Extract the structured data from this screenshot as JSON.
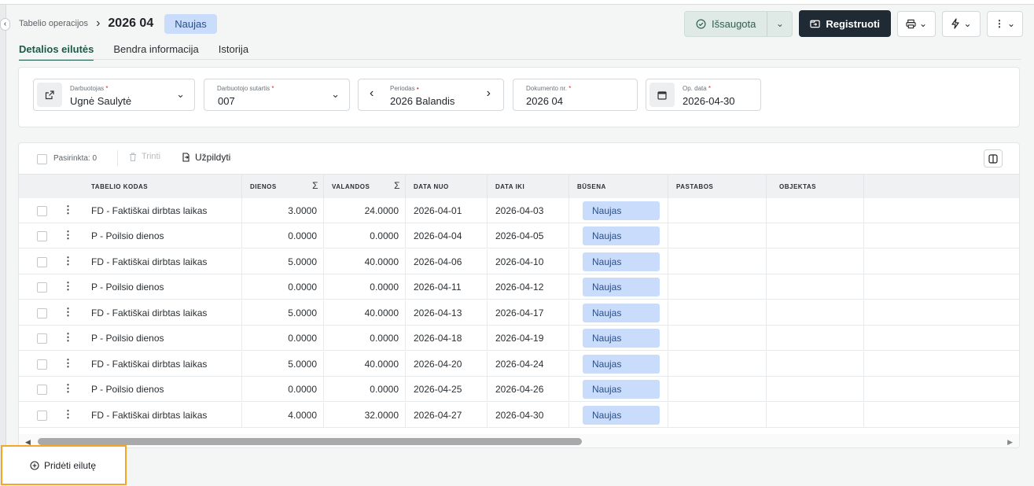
{
  "header": {
    "breadcrumb_link": "Tabelio operacijos",
    "title": "2026 04",
    "status_badge": "Naujas",
    "saved_label": "Išsaugota",
    "register_label": "Registruoti"
  },
  "tabs": [
    {
      "label": "Detalios eilutės",
      "active": true
    },
    {
      "label": "Bendra informacija",
      "active": false
    },
    {
      "label": "Istorija",
      "active": false
    }
  ],
  "filters": {
    "employee": {
      "label": "Darbuotojas",
      "value": "Ugnė Saulytė"
    },
    "contract": {
      "label": "Darbuotojo sutartis",
      "value": "007"
    },
    "period": {
      "label": "Periodas",
      "value": "2026 Balandis"
    },
    "doc_no": {
      "label": "Dokumento nr.",
      "value": "2026 04"
    },
    "op_date": {
      "label": "Op. data",
      "value": "2026-04-30"
    }
  },
  "toolbar": {
    "selected": "Pasirinkta: 0",
    "delete": "Trinti",
    "fill": "Užpildyti"
  },
  "columns": [
    "TABELIO KODAS",
    "DIENOS",
    "VALANDOS",
    "DATA NUO",
    "DATA IKI",
    "BŪSENA",
    "PASTABOS",
    "OBJEKTAS"
  ],
  "rows": [
    {
      "code": "FD - Faktiškai dirbtas laikas",
      "days": "3.0000",
      "hours": "24.0000",
      "from": "2026-04-01",
      "to": "2026-04-03",
      "status": "Naujas"
    },
    {
      "code": "P - Poilsio dienos",
      "days": "0.0000",
      "hours": "0.0000",
      "from": "2026-04-04",
      "to": "2026-04-05",
      "status": "Naujas"
    },
    {
      "code": "FD - Faktiškai dirbtas laikas",
      "days": "5.0000",
      "hours": "40.0000",
      "from": "2026-04-06",
      "to": "2026-04-10",
      "status": "Naujas"
    },
    {
      "code": "P - Poilsio dienos",
      "days": "0.0000",
      "hours": "0.0000",
      "from": "2026-04-11",
      "to": "2026-04-12",
      "status": "Naujas"
    },
    {
      "code": "FD - Faktiškai dirbtas laikas",
      "days": "5.0000",
      "hours": "40.0000",
      "from": "2026-04-13",
      "to": "2026-04-17",
      "status": "Naujas"
    },
    {
      "code": "P - Poilsio dienos",
      "days": "0.0000",
      "hours": "0.0000",
      "from": "2026-04-18",
      "to": "2026-04-19",
      "status": "Naujas"
    },
    {
      "code": "FD - Faktiškai dirbtas laikas",
      "days": "5.0000",
      "hours": "40.0000",
      "from": "2026-04-20",
      "to": "2026-04-24",
      "status": "Naujas"
    },
    {
      "code": "P - Poilsio dienos",
      "days": "0.0000",
      "hours": "0.0000",
      "from": "2026-04-25",
      "to": "2026-04-26",
      "status": "Naujas"
    },
    {
      "code": "FD - Faktiškai dirbtas laikas",
      "days": "4.0000",
      "hours": "32.0000",
      "from": "2026-04-27",
      "to": "2026-04-30",
      "status": "Naujas"
    }
  ],
  "add_row_label": "Pridėti eilutę",
  "colors": {
    "accent": "#1e5a4a",
    "badge_bg": "#c9dcfb",
    "primary_btn": "#1f2a35",
    "highlight": "#f5a623"
  }
}
